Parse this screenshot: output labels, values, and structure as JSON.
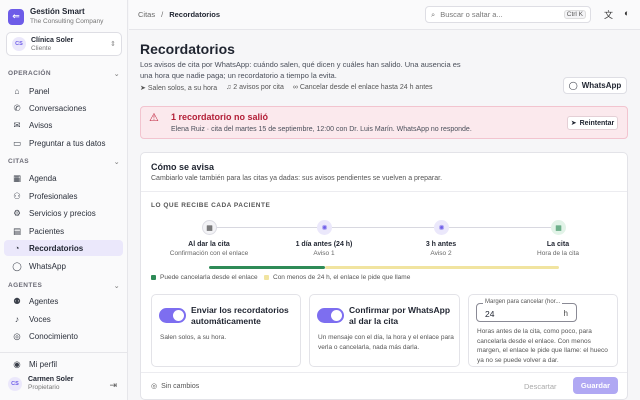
{
  "brand": {
    "logo": "⇐",
    "name": "Gestión Smart",
    "sub": "The Consulting Company"
  },
  "org": {
    "initials": "CS",
    "name": "Clínica Soler",
    "role": "Cliente"
  },
  "sections": {
    "operacion": "OPERACIÓN",
    "citas": "CITAS",
    "agentes": "AGENTES"
  },
  "nav": [
    {
      "label": "Panel",
      "icon": "⌂"
    },
    {
      "label": "Conversaciones",
      "icon": "✆"
    },
    {
      "label": "Avisos",
      "icon": "✉"
    },
    {
      "label": "Preguntar a tus datos",
      "icon": "▭"
    },
    {
      "label": "Agenda",
      "icon": "▦"
    },
    {
      "label": "Profesionales",
      "icon": "⚇"
    },
    {
      "label": "Servicios y precios",
      "icon": "⚙"
    },
    {
      "label": "Pacientes",
      "icon": "▤"
    },
    {
      "label": "Recordatorios",
      "icon": "◔"
    },
    {
      "label": "WhatsApp",
      "icon": "◯"
    },
    {
      "label": "Agentes",
      "icon": "⚉"
    },
    {
      "label": "Voces",
      "icon": "♪"
    },
    {
      "label": "Conocimiento",
      "icon": "◎"
    },
    {
      "label": "Mi perfil",
      "icon": "◉"
    }
  ],
  "user": {
    "initials": "CS",
    "name": "Carmen Soler",
    "role": "Propietario"
  },
  "topbar": {
    "crumb1": "Citas",
    "sep": "/",
    "crumb2": "Recordatorios",
    "search_placeholder": "Buscar o saltar a...",
    "shortcut": "Ctrl K"
  },
  "page": {
    "title": "Recordatorios",
    "description": "Los avisos de cita por WhatsApp: cuándo salen, qué dicen y cuáles han salido. Una ausencia es una hora que nadie paga; un recordatorio a tiempo la evita.",
    "chips": [
      "Salen solos, a su hora",
      "2 avisos por cita",
      "Cancelar desde el enlace hasta 24 h antes"
    ],
    "whatsapp_button": "WhatsApp"
  },
  "alert": {
    "title": "1 recordatorio no salió",
    "text": "Elena Ruiz · cita del martes 15 de septiembre, 12:00 con Dr. Luis Marín. WhatsApp no responde.",
    "retry": "Reintentar"
  },
  "card": {
    "title": "Cómo se avisa",
    "subtitle": "Cambiarlo vale también para las citas ya dadas: sus avisos pendientes se vuelven a preparar.",
    "timeline_label": "LO QUE RECIBE CADA PACIENTE",
    "steps": [
      {
        "title": "Al dar la cita",
        "sub": "Confirmación con el enlace"
      },
      {
        "title": "1 día antes (24 h)",
        "sub": "Aviso 1"
      },
      {
        "title": "3 h antes",
        "sub": "Aviso 2"
      },
      {
        "title": "La cita",
        "sub": "Hora de la cita"
      }
    ],
    "legend": [
      "Puede cancelarla desde el enlace",
      "Con menos de 24 h, el enlace le pide que llame"
    ],
    "options": [
      {
        "title": "Enviar los recordatorios automáticamente",
        "text": "Salen solos, a su hora."
      },
      {
        "title": "Confirmar por WhatsApp al dar la cita",
        "text": "Un mensaje con el día, la hora y el enlace para verla o cancelarla, nada más darla."
      }
    ],
    "margin": {
      "label": "Margen para cancelar (hor...",
      "value": "24",
      "unit": "h",
      "help": "Horas antes de la cita, como poco, para cancelarla desde el enlace. Con menos margen, el enlace le pide que llame: el hueco ya no se puede volver a dar."
    },
    "footer": {
      "status": "Sin cambios",
      "discard": "Descartar",
      "save": "Guardar"
    }
  },
  "colors": {
    "accent": "#6d5ce8",
    "danger": "#b32038",
    "green": "#2e8b57",
    "yellow": "#f1e4a0"
  }
}
